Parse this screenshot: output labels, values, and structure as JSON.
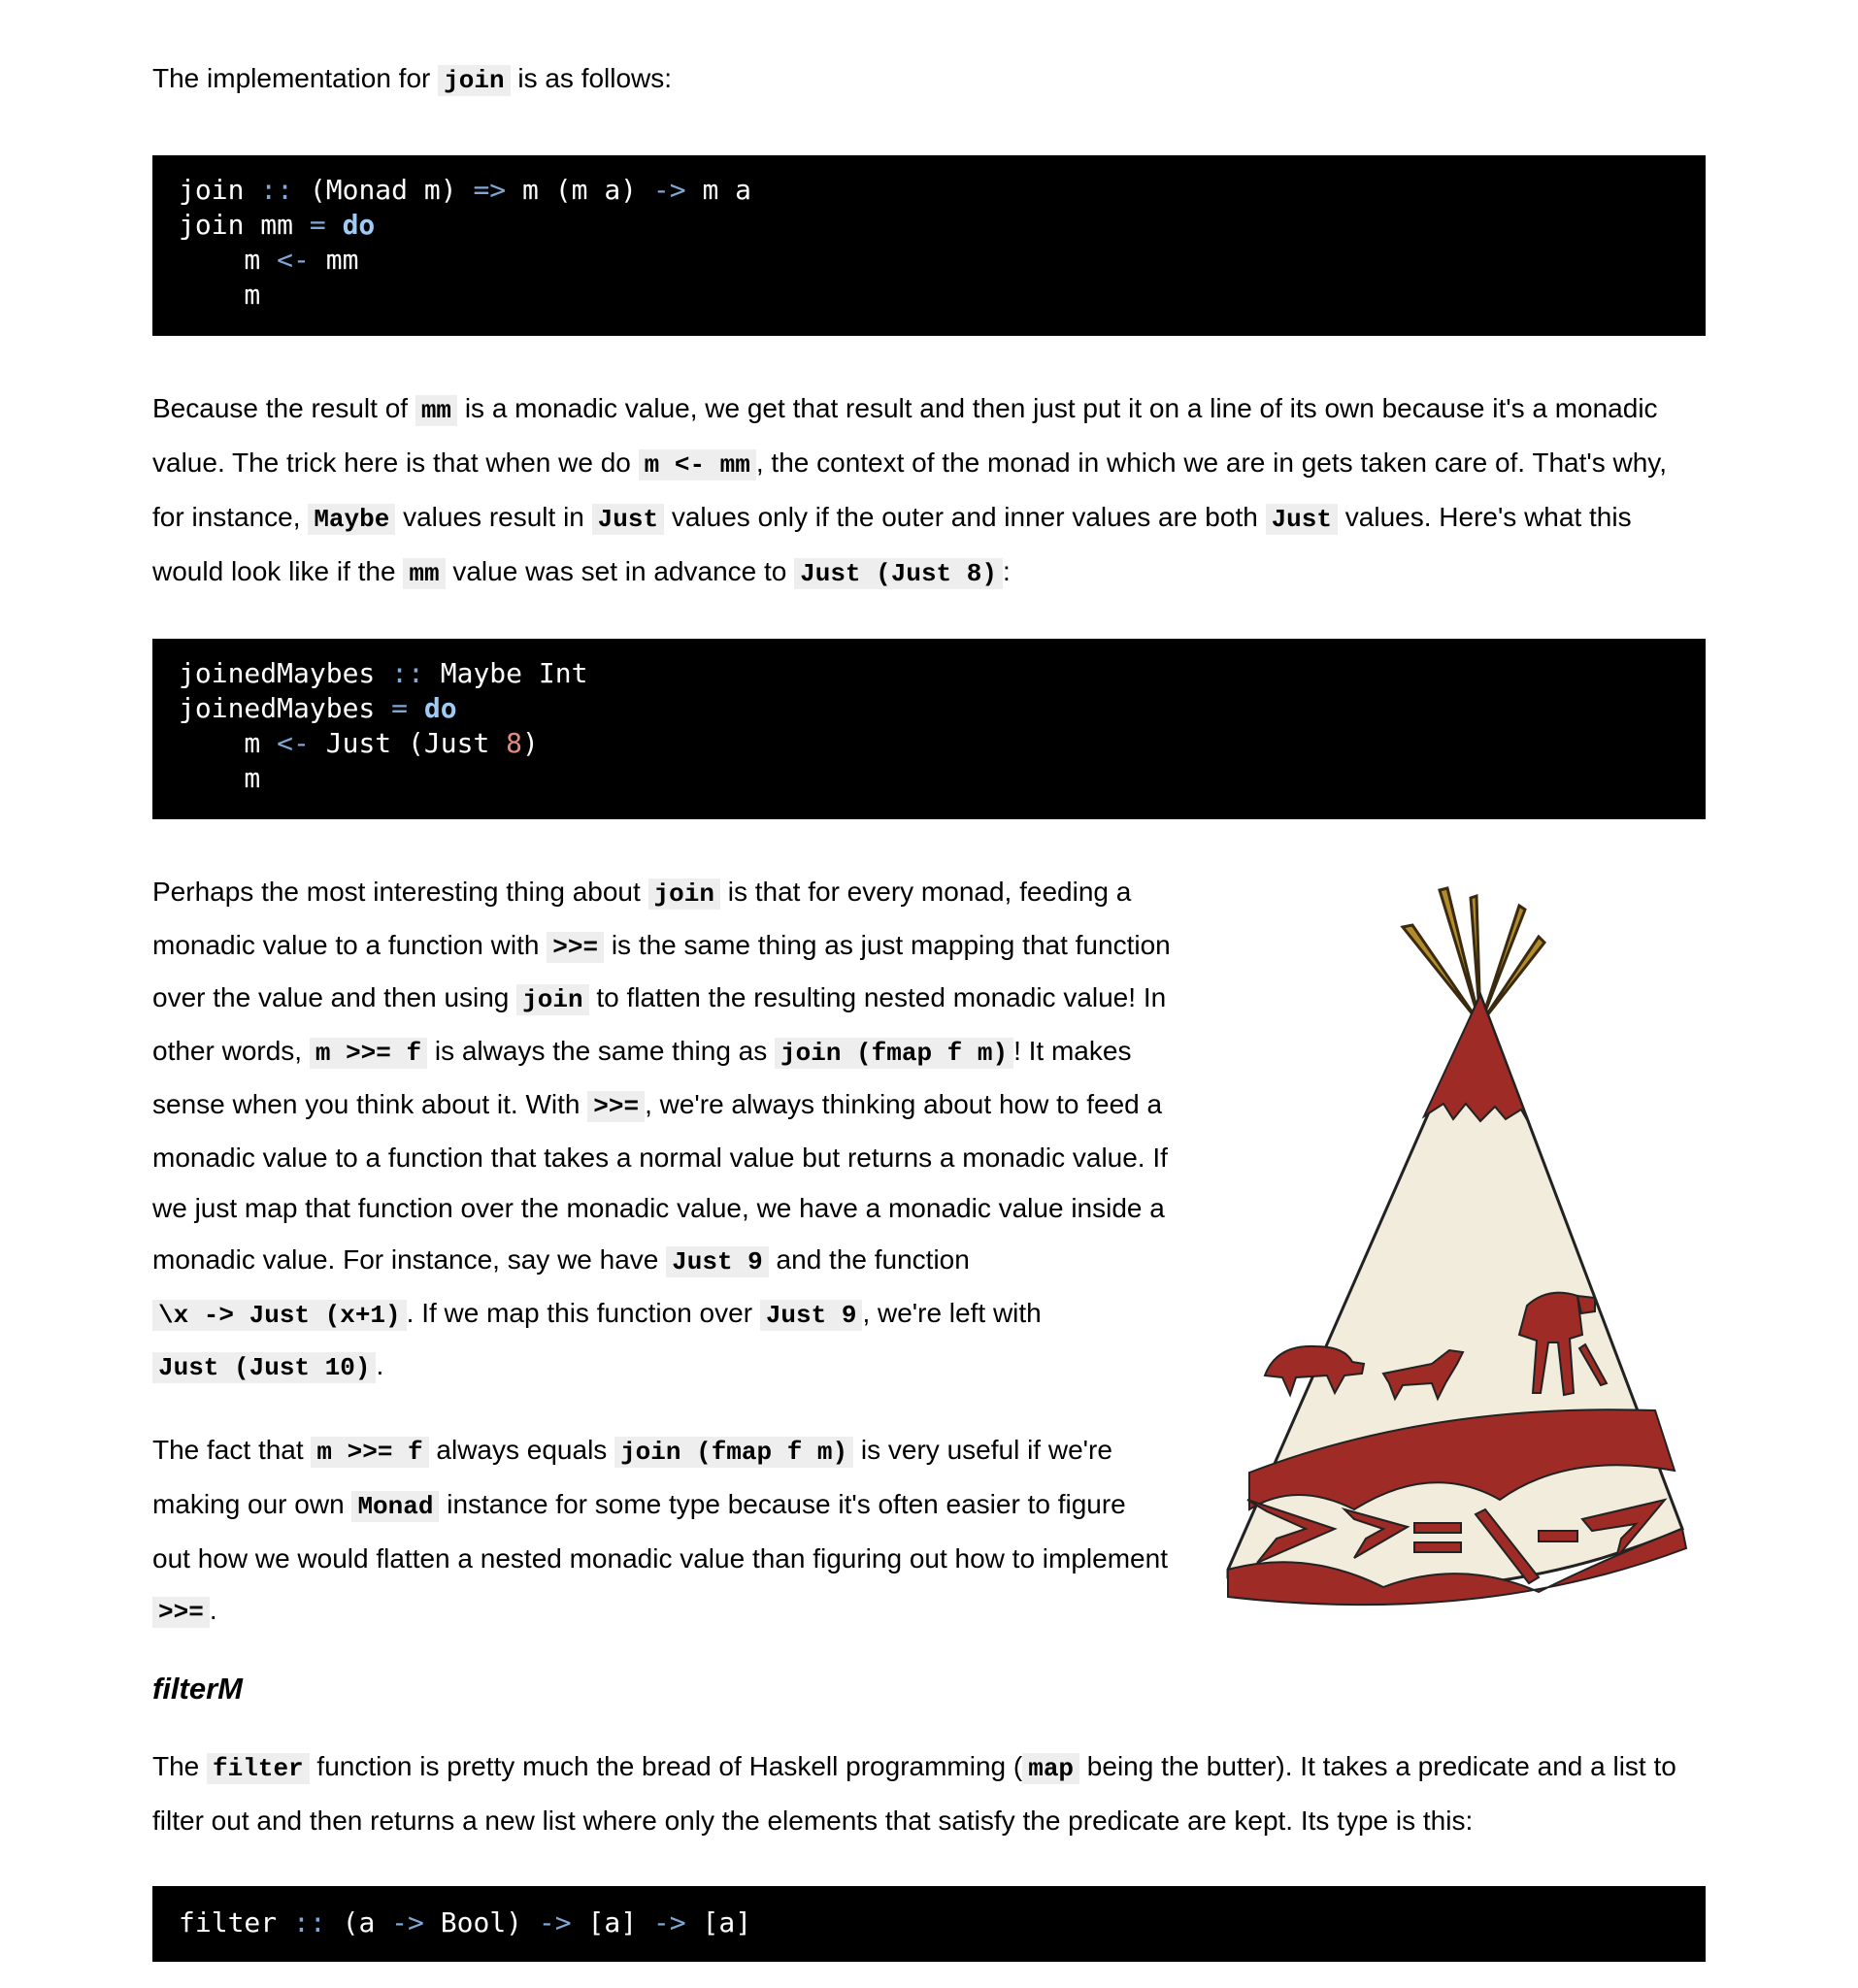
{
  "p1": {
    "a": "The implementation for ",
    "code": "join",
    "b": " is as follows:"
  },
  "code1": [
    [
      "join ",
      "::",
      " (Monad m) ",
      "=>",
      " m (m a) ",
      "->",
      " m a"
    ],
    [
      "join mm ",
      "=",
      " ",
      "do"
    ],
    [
      "    m ",
      "<-",
      " mm"
    ],
    [
      "    m"
    ]
  ],
  "p2": {
    "l1a": "Because the result of ",
    "l1c": "mm",
    "l1b": " is a monadic value, we get that result and then just put it on a line of its own because it's a monadic",
    "l2a": "value. The trick here is that when we do ",
    "l2c": "m <- mm",
    "l2b": ", the context of the monad in which we are in gets taken care of. That's why,",
    "l3a": "for instance, ",
    "l3c1": "Maybe",
    "l3b": " values result in ",
    "l3c2": "Just",
    "l3d": " values only if the outer and inner values are both ",
    "l3c3": "Just",
    "l3e": " values. Here's what this",
    "l4a": "would look like if the ",
    "l4c1": "mm",
    "l4b": " value was set in advance to ",
    "l4c2": "Just (Just 8)",
    "l4d": ":"
  },
  "code2": {
    "l1a": "joinedMaybes ",
    "l1op": "::",
    "l1b": " Maybe Int",
    "l2a": "joinedMaybes ",
    "l2op": "=",
    "l2kw": "do",
    "l3a": "    m ",
    "l3op": "<-",
    "l3b": " Just (Just ",
    "l3num": "8",
    "l3c": ")",
    "l4a": "    m"
  },
  "p3": {
    "l1a": "Perhaps the most interesting thing about ",
    "l1c": "join",
    "l1b": " is that for every monad, feeding a",
    "l2a": "monadic value to a function with ",
    "l2c": ">>=",
    "l2b": " is the same thing as just mapping that function",
    "l3a": "over the value and then using ",
    "l3c": "join",
    "l3b": " to flatten the resulting nested monadic value! In",
    "l4a": "other words, ",
    "l4c1": "m >>= f",
    "l4b": " is always the same thing as ",
    "l4c2": "join (fmap f m)",
    "l4d": "! It makes",
    "l5a": "sense when you think about it. With ",
    "l5c": ">>=",
    "l5b": ", we're always thinking about how to feed a",
    "l6": "monadic value to a function that takes a normal value but returns a monadic value. If",
    "l7": "we just map that function over the monadic value, we have a monadic value inside a",
    "l8a": "monadic value. For instance, say we have ",
    "l8c": "Just 9",
    "l8b": " and the function",
    "l9c1": "\\x -> Just (x+1)",
    "l9a": ". If we map this function over ",
    "l9c2": "Just 9",
    "l9b": ", we're left with",
    "l10c": "Just (Just 10)",
    "l10a": "."
  },
  "p4": {
    "l1a": "The fact that ",
    "l1c1": "m >>= f",
    "l1b": " always equals ",
    "l1c2": "join (fmap f m)",
    "l1d": " is very useful if we're",
    "l2a": "making our own ",
    "l2c": "Monad",
    "l2b": " instance for some type because it's often easier to figure",
    "l3": "out how we would flatten a nested monadic value than figuring out how to implement",
    "l4c": ">>=",
    "l4a": "."
  },
  "heading": "filterM",
  "p5": {
    "l1a": "The ",
    "l1c1": "filter",
    "l1b": " function is pretty much the bread of Haskell programming (",
    "l1c2": "map",
    "l1d": " being the butter). It takes a predicate and a list to",
    "l2": "filter out and then returns a new list where only the elements that satisfy the predicate are kept. Its type is this:"
  },
  "code3": {
    "a": "filter ",
    "op1": "::",
    "b": " (a ",
    "op2": "->",
    "c": " Bool) ",
    "op3": "->",
    "d": " [a] ",
    "op4": "->",
    "e": " [a]"
  },
  "colors": {
    "code_bg": "#000000",
    "inline_code_bg": "#eeeeee",
    "teepee_red": "#9e2b25",
    "teepee_cream": "#f1ecdc"
  },
  "illustration": "teepee-icon"
}
